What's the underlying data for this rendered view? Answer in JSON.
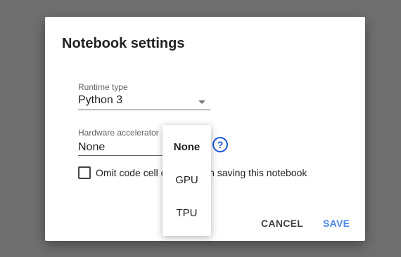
{
  "dialog": {
    "title": "Notebook settings",
    "runtime": {
      "label": "Runtime type",
      "value": "Python 3"
    },
    "accelerator": {
      "label": "Hardware accelerator",
      "value": "None",
      "options": [
        "None",
        "GPU",
        "TPU"
      ],
      "selected": "None"
    },
    "help_icon": "help-circle-icon",
    "omit_output": {
      "label": "Omit code cell output when saving this notebook",
      "checked": false
    },
    "buttons": {
      "cancel": "CANCEL",
      "save": "SAVE"
    }
  },
  "colors": {
    "accent": "#4a86e8",
    "help": "#1a56db",
    "backdrop": "#6f6f6f"
  }
}
